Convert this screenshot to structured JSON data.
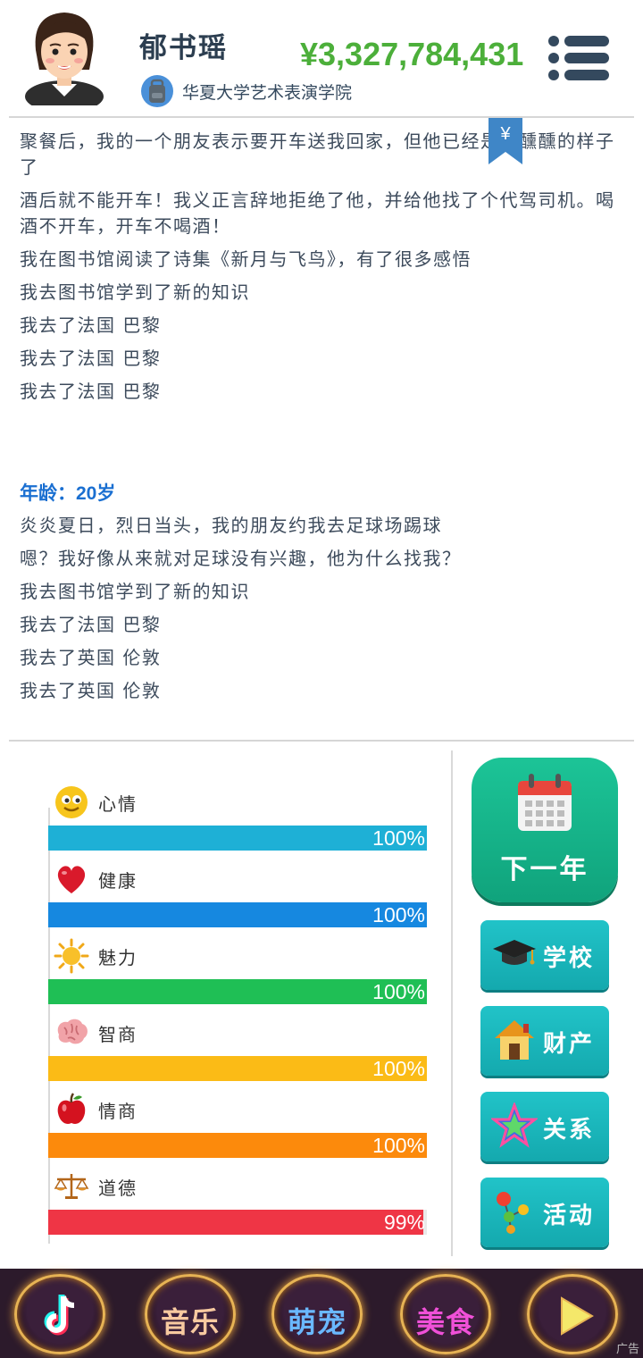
{
  "header": {
    "name": "郁书瑶",
    "money": "¥3,327,784,431",
    "school": "华夏大学艺术表演学院"
  },
  "bookmark_symbol": "¥",
  "log_top": [
    "聚餐后，我的一个朋友表示要开车送我回家，但他已经是醉醺醺的样子了",
    "酒后就不能开车！我义正言辞地拒绝了他，并给他找了个代驾司机。喝酒不开车，开车不喝酒！",
    "我在图书馆阅读了诗集《新月与飞鸟》，有了很多感悟",
    "我去图书馆学到了新的知识",
    "我去了法国 巴黎",
    "我去了法国 巴黎",
    "我去了法国 巴黎"
  ],
  "age_heading": "年龄：20岁",
  "log_bottom": [
    "炎炎夏日，烈日当头，我的朋友约我去足球场踢球",
    "嗯？我好像从来就对足球没有兴趣，他为什么找我？",
    "我去图书馆学到了新的知识",
    "我去了法国 巴黎",
    "我去了英国 伦敦",
    "我去了英国 伦敦"
  ],
  "stats": [
    {
      "label": "心情",
      "value": "100%",
      "fraction": 1.0,
      "color": "#1eb0d6",
      "icon": "smiley-icon"
    },
    {
      "label": "健康",
      "value": "100%",
      "fraction": 1.0,
      "color": "#1688e0",
      "icon": "heart-icon"
    },
    {
      "label": "魅力",
      "value": "100%",
      "fraction": 1.0,
      "color": "#1fbf55",
      "icon": "sun-icon"
    },
    {
      "label": "智商",
      "value": "100%",
      "fraction": 1.0,
      "color": "#fbbb16",
      "icon": "brain-icon"
    },
    {
      "label": "情商",
      "value": "100%",
      "fraction": 1.0,
      "color": "#fc8a0c",
      "icon": "apple-icon"
    },
    {
      "label": "道德",
      "value": "99%",
      "fraction": 0.99,
      "color": "#ef3545",
      "icon": "scales-icon"
    }
  ],
  "actions": {
    "next_year": "下一年",
    "school": "学校",
    "property": "财产",
    "relations": "关系",
    "activity": "活动"
  },
  "bottom_bar": {
    "items": [
      {
        "label": "",
        "icon": "tiktok-icon"
      },
      {
        "label": "音乐",
        "color": "#f7c9a0"
      },
      {
        "label": "萌宠",
        "color": "#6ab8ff"
      },
      {
        "label": "美食",
        "color": "#f050d8"
      },
      {
        "label": "",
        "icon": "play-icon"
      }
    ],
    "ad_label": "广告"
  }
}
